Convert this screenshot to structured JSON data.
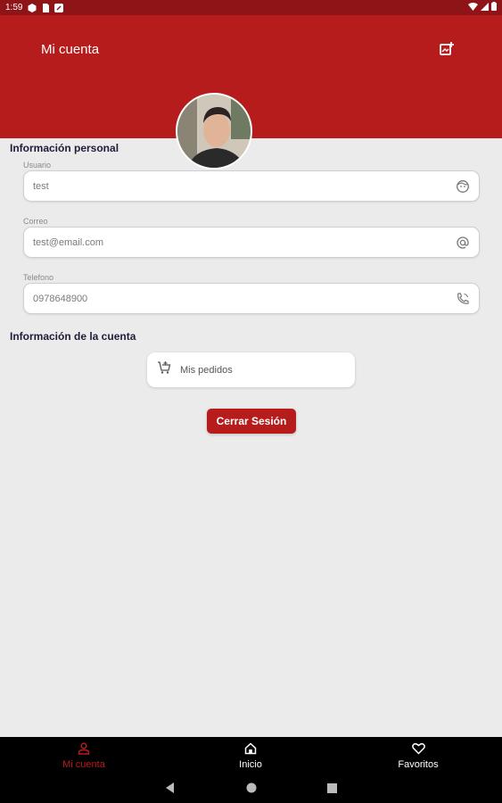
{
  "status_bar": {
    "time": "1:59"
  },
  "app_bar": {
    "title": "Mi cuenta"
  },
  "personal_section": {
    "title": "Información personal",
    "fields": [
      {
        "label": "Usuario",
        "value": "test"
      },
      {
        "label": "Correo",
        "value": "test@email.com"
      },
      {
        "label": "Telefono",
        "value": "0978648900"
      }
    ]
  },
  "account_section": {
    "title": "Información de la cuenta",
    "orders_label": "Mis pedidos"
  },
  "logout_label": "Cerrar Sesión",
  "bottom_nav": {
    "items": [
      {
        "label": "Mi cuenta",
        "icon": "person-icon"
      },
      {
        "label": "Inicio",
        "icon": "home-icon"
      },
      {
        "label": "Favoritos",
        "icon": "heart-icon"
      }
    ]
  },
  "colors": {
    "primary": "#b71c1c",
    "status_bar": "#8e1417",
    "background": "#ebebeb"
  }
}
